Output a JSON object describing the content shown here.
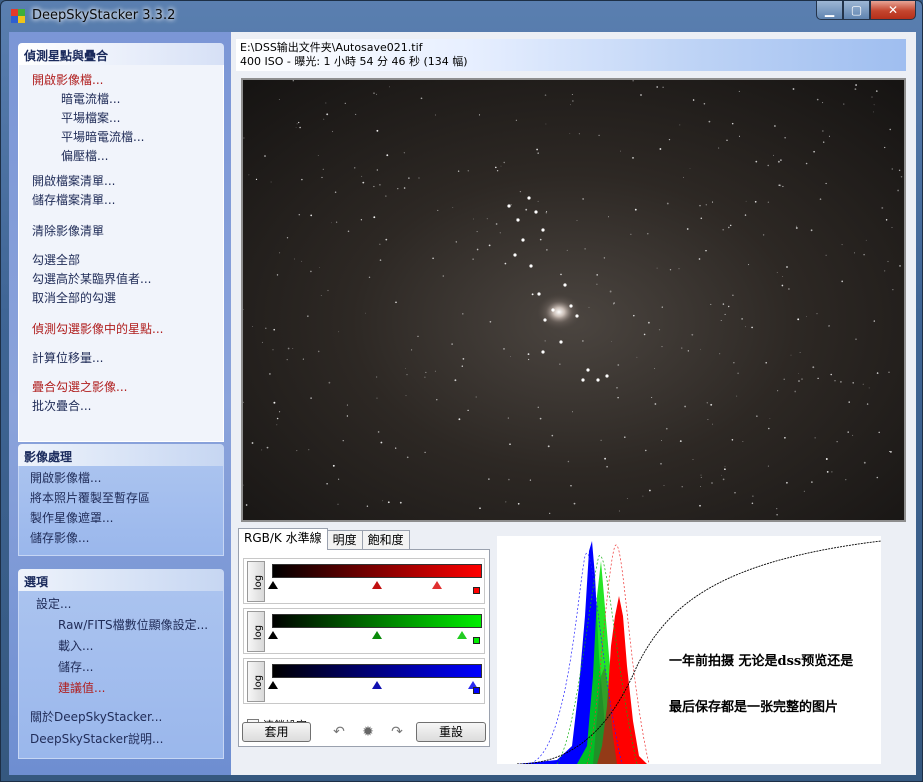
{
  "window": {
    "title": "DeepSkyStacker 3.3.2",
    "buttons": {
      "minimize": "▁",
      "maximize": "▢",
      "close": "✕"
    }
  },
  "sidebar": {
    "register_panel": {
      "title": "偵測星點與疊合",
      "items": [
        {
          "label": "開啟影像檔...",
          "color": "red"
        },
        {
          "label": "暗電流檔..."
        },
        {
          "label": "平場檔案..."
        },
        {
          "label": "平場暗電流檔..."
        },
        {
          "label": "偏壓檔..."
        },
        {
          "label": "開啟檔案清單..."
        },
        {
          "label": "儲存檔案清單..."
        },
        {
          "label": "清除影像清單"
        },
        {
          "label": "勾選全部"
        },
        {
          "label": "勾選高於某臨界值者..."
        },
        {
          "label": "取消全部的勾選"
        },
        {
          "label": "偵測勾選影像中的星點...",
          "color": "red"
        },
        {
          "label": "計算位移量..."
        },
        {
          "label": "疊合勾選之影像...",
          "color": "red"
        },
        {
          "label": "批次疊合..."
        }
      ]
    },
    "processing_panel": {
      "title": "影像處理",
      "items": [
        {
          "label": "開啟影像檔..."
        },
        {
          "label": "將本照片覆製至暫存區"
        },
        {
          "label": "製作星像遮罩..."
        },
        {
          "label": "儲存影像..."
        }
      ]
    },
    "options_panel": {
      "title": "選項",
      "items": [
        {
          "label": "設定..."
        },
        {
          "label": "Raw/FITS檔數位顯像設定..."
        },
        {
          "label": "載入..."
        },
        {
          "label": "儲存..."
        },
        {
          "label": "建議值...",
          "color": "red"
        },
        {
          "label": "關於DeepSkyStacker..."
        },
        {
          "label": "DeepSkyStacker說明..."
        }
      ]
    }
  },
  "info": {
    "path": "E:\\DSS输出文件夹\\Autosave021.tif",
    "exposure": "400 ISO - 曝光: 1 小時 54 分 46 秒 (134 幅)"
  },
  "tabs": [
    {
      "label": "RGB/K 水準線",
      "active": true
    },
    {
      "label": "明度"
    },
    {
      "label": "飽和度"
    }
  ],
  "levels": {
    "log_label": "log",
    "channels": [
      {
        "name": "red",
        "color": "#ff0000",
        "mid": 0.5,
        "high": 0.79
      },
      {
        "name": "green",
        "color": "#00dd00",
        "mid": 0.5,
        "high": 0.93
      },
      {
        "name": "blue",
        "color": "#0000ff",
        "mid": 0.5,
        "high": 0.96
      }
    ],
    "link_label": "連鎖設定",
    "apply_label": "套用",
    "reset_label": "重設",
    "icons": {
      "undo": "undo-icon",
      "settings": "gear-icon",
      "redo": "redo-icon"
    }
  },
  "annotation": {
    "line1": "一年前拍摄  无论是dss预览还是",
    "line2": "最后保存都是一张完整的图片"
  }
}
